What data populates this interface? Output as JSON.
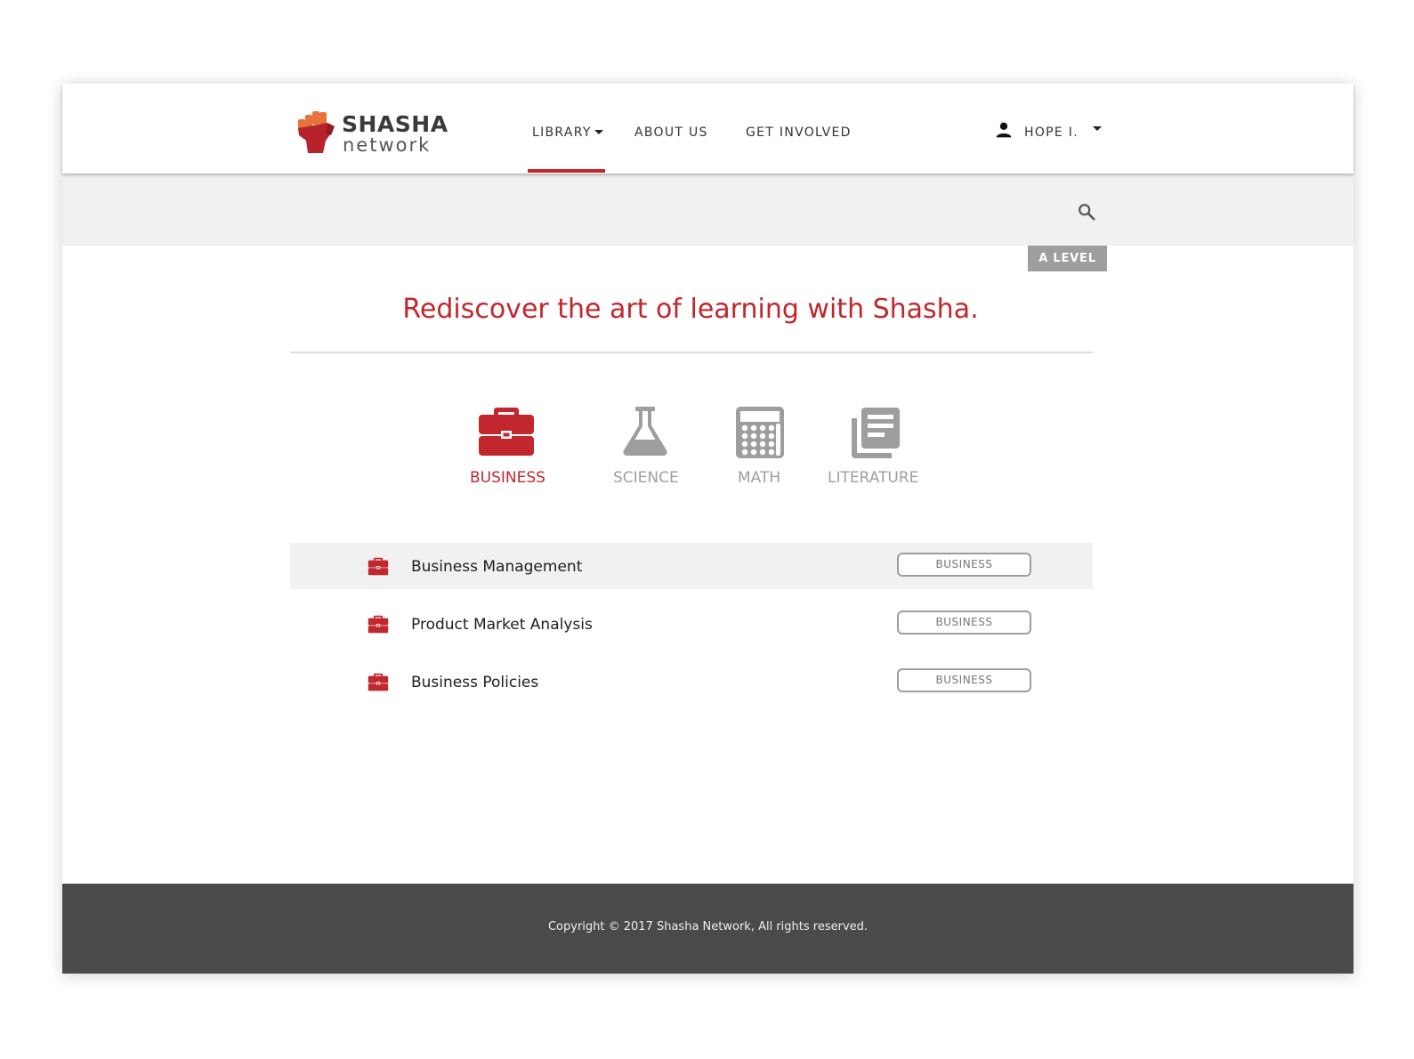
{
  "brand": {
    "name": "SHASHA",
    "sub": "network"
  },
  "nav": {
    "items": [
      {
        "label": "LIBRARY"
      },
      {
        "label": "ABOUT US"
      },
      {
        "label": "GET INVOLVED"
      }
    ],
    "active": "LIBRARY"
  },
  "user": {
    "name": "HOPE I."
  },
  "level": {
    "label": "A  LEVEL"
  },
  "headline": "Rediscover the art of learning with Shasha.",
  "categories": [
    {
      "label": "BUSINESS",
      "icon": "briefcase-icon",
      "active": true
    },
    {
      "label": "SCIENCE",
      "icon": "flask-icon",
      "active": false
    },
    {
      "label": "MATH",
      "icon": "calculator-icon",
      "active": false
    },
    {
      "label": "LITERATURE",
      "icon": "library-books-icon",
      "active": false
    }
  ],
  "courses": [
    {
      "title": "Business Management",
      "tag": "BUSINESS"
    },
    {
      "title": "Product Market Analysis",
      "tag": "BUSINESS"
    },
    {
      "title": "Business Policies",
      "tag": "BUSINESS"
    }
  ],
  "footer": {
    "copyright": "Copyright © 2017 Shasha Network, All rights reserved."
  },
  "colors": {
    "accent": "#c1272d",
    "muted": "#9e9e9e",
    "band": "#f1f1f1",
    "footer": "#4a4a4a"
  }
}
